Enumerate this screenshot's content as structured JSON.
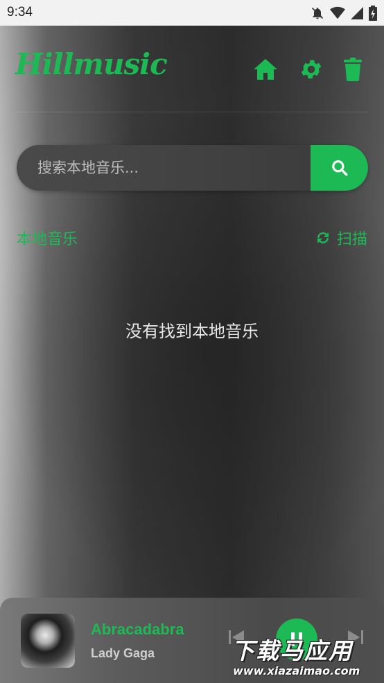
{
  "status_bar": {
    "time": "9:34"
  },
  "app": {
    "logo_text": "Hillmusic",
    "accent_color": "#1db954"
  },
  "header": {
    "icons": [
      "home-icon",
      "gear-icon",
      "trash-icon"
    ]
  },
  "search": {
    "placeholder": "搜索本地音乐...",
    "value": ""
  },
  "section": {
    "title": "本地音乐",
    "scan_label": "扫描"
  },
  "main": {
    "empty_message": "没有找到本地音乐"
  },
  "player": {
    "title": "Abracadabra",
    "artist": "Lady Gaga"
  },
  "watermark": {
    "line1": "下载马应用",
    "line2": "www.xiazaimao.com"
  }
}
